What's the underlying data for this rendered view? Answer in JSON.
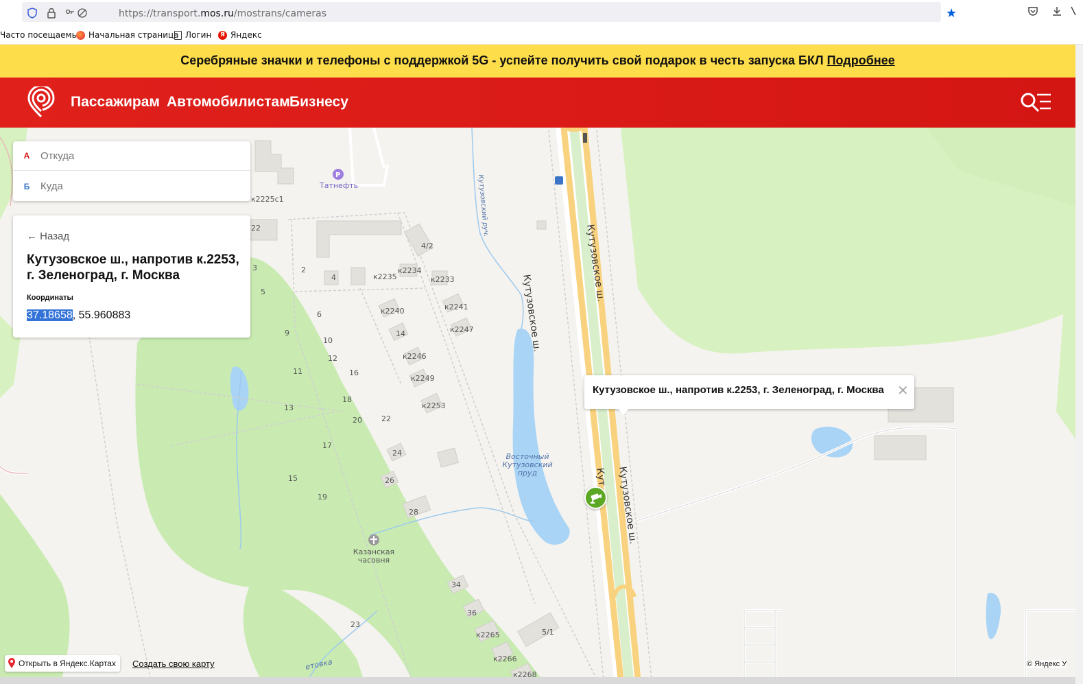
{
  "browser": {
    "url_prefix": "https://transport.",
    "url_domain": "mos.ru",
    "url_path": "/mostrans/cameras",
    "bookmarks": [
      {
        "label": "Часто посещаемые"
      },
      {
        "label": "Начальная страница"
      },
      {
        "label": "Логин"
      },
      {
        "label": "Яндекс"
      }
    ]
  },
  "banner": {
    "text": "Серебряные значки и телефоны с поддержкой 5G - успейте получить свой подарок в честь запуска БКЛ ",
    "link": "Подробнее"
  },
  "nav": {
    "items": [
      "Пассажирам",
      "Автомобилистам",
      "Бизнесу"
    ]
  },
  "route": {
    "from_letter": "А",
    "from_placeholder": "Откуда",
    "to_letter": "Б",
    "to_placeholder": "Куда"
  },
  "info": {
    "back": "← Назад",
    "title": "Кутузовское ш., напротив к.2253, г. Зеленоград, г. Москва",
    "coord_label": "Координаты",
    "coord_lon": "37.18658",
    "coord_rest": ", 55.960883"
  },
  "balloon": {
    "text": "Кутузовское ш., напротив к.2253, г. Зеленоград, г. Москва"
  },
  "map": {
    "open_yandex": "Открыть в Яндекс.Картах",
    "create_map": "Создать свою карту",
    "copyright": "© Яндекс У",
    "labels": {
      "tatneft": "Татнефть",
      "road1": "Кутузовское ш.",
      "road2": "Кутузовское ш.",
      "road3": "Кут",
      "road4": "Кутузовское ш.",
      "stream": "Кутузовский руч.",
      "pond": "Восточный Кутузовский пруд",
      "chapel": "Казанская часовня",
      "k2225": "к2225с1",
      "h22": "22",
      "h4_2": "4/2",
      "h2": "2",
      "h4": "4",
      "k2235": "к2235",
      "k2234": "к2234",
      "k2233": "к2233",
      "h3": "3",
      "h5": "5",
      "h6": "6",
      "k2240": "к2240",
      "k2241": "к2241",
      "k2247": "к2247",
      "h9": "9",
      "h10": "10",
      "h14": "14",
      "h12": "12",
      "k2246": "к2246",
      "h16": "16",
      "h11": "11",
      "k2249": "к2249",
      "h18": "18",
      "h13": "13",
      "k2253": "к2253",
      "h20": "20",
      "h22b": "22",
      "h17": "17",
      "h24": "24",
      "h15": "15",
      "h26": "26",
      "h19": "19",
      "h28": "28",
      "h34": "34",
      "h36": "36",
      "k2265": "к2265",
      "h5_1": "5/1",
      "h23": "23",
      "k2266": "к2266",
      "k2268": "к2268",
      "street_bottom": "етовка"
    }
  },
  "colors": {
    "brand_red": "#d41613",
    "banner_yellow": "#fedd4b",
    "camera_green": "#5ca824",
    "selection_blue": "#3373d8"
  }
}
